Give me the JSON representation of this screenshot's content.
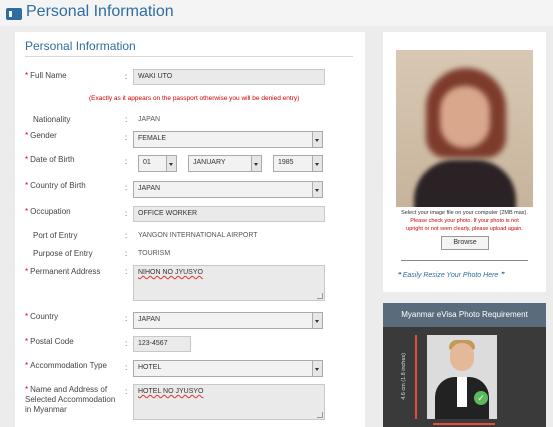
{
  "page": {
    "title": "Personal Information"
  },
  "form": {
    "title": "Personal Information",
    "full_name": {
      "label": "Full Name",
      "value": "WAKI UTO"
    },
    "name_note": "(Exactly as it appears on the passport otherwise you will be denied entry)",
    "nationality": {
      "label": "Nationality",
      "value": "JAPAN"
    },
    "gender": {
      "label": "Gender",
      "value": "FEMALE"
    },
    "dob": {
      "label": "Date of Birth",
      "day": "01",
      "month": "JANUARY",
      "year": "1985"
    },
    "country_of_birth": {
      "label": "Country of Birth",
      "value": "JAPAN"
    },
    "occupation": {
      "label": "Occupation",
      "value": "OFFICE WORKER"
    },
    "port_of_entry": {
      "label": "Port of Entry",
      "value": "YANGON INTERNATIONAL AIRPORT"
    },
    "purpose_of_entry": {
      "label": "Purpose of Entry",
      "value": "TOURISM"
    },
    "permanent_address": {
      "label": "Permanent Address",
      "value": "NIHON NO JYUSYO"
    },
    "country": {
      "label": "Country",
      "value": "JAPAN"
    },
    "postal_code": {
      "label": "Postal Code",
      "value": "123-4567"
    },
    "accommodation_type": {
      "label": "Accommodation Type",
      "value": "HOTEL"
    },
    "accommodation_address": {
      "label": "Name and Address of Selected Accommodation in Myanmar",
      "value": "HOTEL NO JYUSYO"
    }
  },
  "photo_panel": {
    "instructions_line1": "Select your image file on your computer (2MB max).",
    "instructions_line2": "Please check your photo. If your photo is not",
    "instructions_line3": "upright or not seen clearly, please upload again.",
    "browse_label": "Browse",
    "resize_link": "Easily Resize Your Photo Here"
  },
  "requirement_panel": {
    "title": "Myanmar eVisa Photo Requirement",
    "height_label": "4.6 cm (1.8 inches)"
  },
  "colors": {
    "accent": "#2f6da0",
    "required": "#dd0000",
    "note": "#cc0000"
  }
}
